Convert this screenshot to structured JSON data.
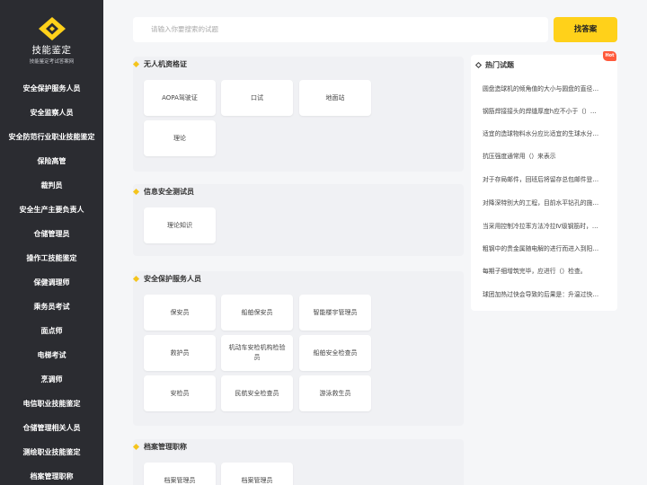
{
  "brand": {
    "title": "技能鉴定",
    "subtitle": "技能鉴定考试答案网",
    "accent": "#ffd11a",
    "sidebar_bg": "#2b2c31"
  },
  "sidebar": {
    "items": [
      {
        "label": "安全保护服务人员"
      },
      {
        "label": "安全监察人员"
      },
      {
        "label": "安全防范行业职业技能鉴定"
      },
      {
        "label": "保险高管"
      },
      {
        "label": "裁判员"
      },
      {
        "label": "安全生产主要负责人"
      },
      {
        "label": "仓储管理员"
      },
      {
        "label": "操作工技能鉴定"
      },
      {
        "label": "保健调理师"
      },
      {
        "label": "乘务员考试"
      },
      {
        "label": "面点师"
      },
      {
        "label": "电梯考试"
      },
      {
        "label": "烹调师"
      },
      {
        "label": "电信职业技能鉴定"
      },
      {
        "label": "仓储管理相关人员"
      },
      {
        "label": "测绘职业技能鉴定"
      },
      {
        "label": "档案管理职称"
      }
    ]
  },
  "search": {
    "placeholder": "请输入你要搜索的试题",
    "button_label": "找答案"
  },
  "sections": [
    {
      "title": "无人机资格证",
      "items": [
        "AOPA驾驶证",
        "口试",
        "地面站",
        "理论"
      ]
    },
    {
      "title": "信息安全测试员",
      "items": [
        "理论知识"
      ]
    },
    {
      "title": "安全保护服务人员",
      "items": [
        "保安员",
        "船舶保安员",
        "智能楼宇管理员",
        "救护员",
        "机动车安检机构检验员",
        "船舶安全检查员",
        "安检员",
        "民航安全检查员",
        "游泳救生员"
      ]
    },
    {
      "title": "档案管理职称",
      "items": [
        "档案管理员",
        "档案管理员"
      ]
    }
  ],
  "hot": {
    "badge": "Hot",
    "title": "热门试题",
    "items": [
      "圆盘造球机的倾角值的大小与圆盘的直径…",
      "钢筋焊接接头的焊缝厚度h应不小于（）…",
      "适宜的造球物料水分应比适宜的生球水分…",
      "抗压强度通常用（）来表示",
      "对于存局邮件，回班后将留存总包邮件登…",
      "对降深特别大的工程，目前水平钻孔的施…",
      "当采用控制冷拉率方法冷拉Ⅳ级钢筋时，…",
      "粗钢中的贵金属随电解的进行而进入到阳…",
      "每期子细增筑完毕，应进行（）检查。",
      "球团加热过快会导致的后果是：升温过快…"
    ]
  }
}
